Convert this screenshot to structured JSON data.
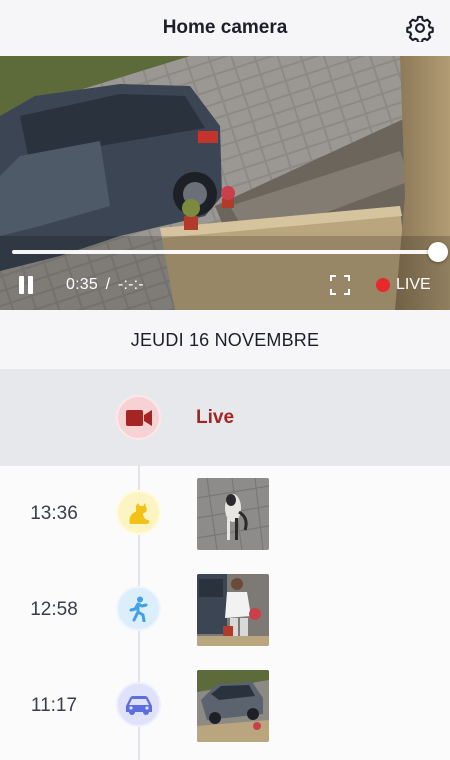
{
  "header": {
    "title": "Home camera",
    "settings_icon": "gear-icon"
  },
  "player": {
    "progress_fraction": 1.0,
    "elapsed": "0:35",
    "separator": "/",
    "duration": "-:-:-",
    "live_label": "LIVE",
    "pause_icon": "pause-icon",
    "fullscreen_icon": "fullscreen-icon",
    "live_dot_color": "#e8282a"
  },
  "date_label": "JEUDI 16 NOVEMBRE",
  "timeline": {
    "live": {
      "label": "Live",
      "icon": "video-camera-icon",
      "color": "#a52424"
    },
    "events": [
      {
        "time": "13:36",
        "icon": "cat-icon",
        "icon_bg": "#fdf4c3",
        "icon_color": "#f2c21a",
        "thumb": "cat-thumbnail"
      },
      {
        "time": "12:58",
        "icon": "person-walking-icon",
        "icon_bg": "#dcedfb",
        "icon_color": "#42a1e6",
        "thumb": "person-thumbnail"
      },
      {
        "time": "11:17",
        "icon": "car-icon",
        "icon_bg": "#dfe2fa",
        "icon_color": "#5e6ee0",
        "thumb": "car-thumbnail"
      }
    ]
  }
}
